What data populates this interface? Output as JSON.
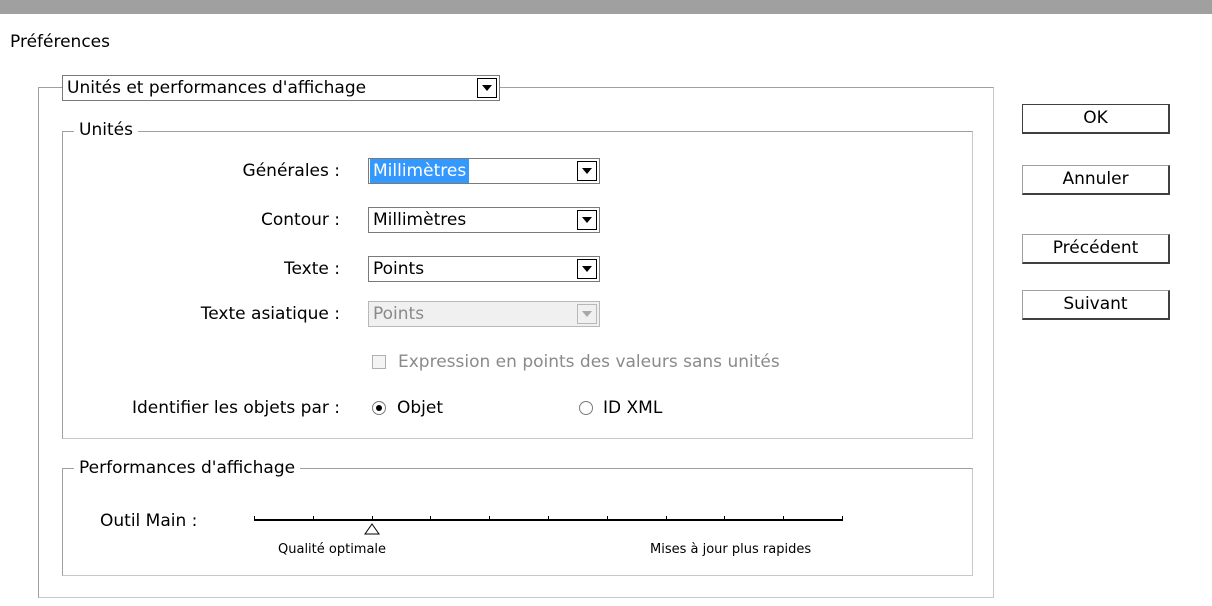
{
  "window": {
    "title": "Préférences"
  },
  "section_dropdown": {
    "value": "Unités et performances d'affichage"
  },
  "units_group": {
    "legend": "Unités",
    "fields": [
      {
        "label": "Générales :",
        "value": "Millimètres",
        "highlighted": true,
        "enabled": true
      },
      {
        "label": "Contour :",
        "value": "Millimètres",
        "highlighted": false,
        "enabled": true
      },
      {
        "label": "Texte :",
        "value": "Points",
        "highlighted": false,
        "enabled": true
      },
      {
        "label": "Texte asiatique :",
        "value": "Points",
        "highlighted": false,
        "enabled": false
      }
    ],
    "checkbox": {
      "label": "Expression en points des valeurs sans unités",
      "checked": false,
      "enabled": false
    },
    "identify": {
      "label": "Identifier les objets par :",
      "options": [
        {
          "label": "Objet",
          "selected": true
        },
        {
          "label": "ID XML",
          "selected": false
        }
      ]
    }
  },
  "performance_group": {
    "legend": "Performances d'affichage",
    "hand_tool": {
      "label": "Outil Main :",
      "steps": 11,
      "selected_step": 2,
      "min_label": "Qualité optimale",
      "max_label": "Mises à jour plus rapides"
    }
  },
  "buttons": {
    "ok": "OK",
    "cancel": "Annuler",
    "previous": "Précédent",
    "next": "Suivant"
  },
  "colors": {
    "selection": "#3399ff",
    "disabled_text": "#8a8a8a",
    "border": "#a0a0a0"
  }
}
